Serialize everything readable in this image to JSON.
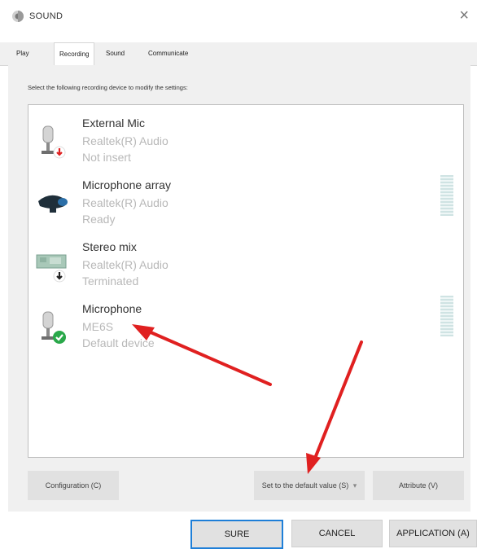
{
  "window": {
    "title": "SOUND",
    "close_glyph": "×"
  },
  "tabs": [
    {
      "label": "Play",
      "active": false
    },
    {
      "label": "Recording",
      "active": true
    },
    {
      "label": "Sound",
      "active": false
    },
    {
      "label": "Communicate",
      "active": false
    }
  ],
  "instruction": "Select the following recording device to modify the settings:",
  "devices": [
    {
      "name": "External Mic",
      "driver": "Realtek(R) Audio",
      "status": "Not insert",
      "icon": "microphone-icon",
      "badge": "red-down-arrow",
      "meter": false
    },
    {
      "name": "Microphone array",
      "driver": "Realtek(R) Audio",
      "status": "Ready",
      "icon": "webcam-icon",
      "badge": "none",
      "meter": true
    },
    {
      "name": "Stereo mix",
      "driver": "Realtek(R) Audio",
      "status": "Terminated",
      "icon": "sound-card-icon",
      "badge": "black-down-arrow",
      "meter": false
    },
    {
      "name": "Microphone",
      "driver": "ME6S",
      "status": "Default device",
      "icon": "microphone-icon",
      "badge": "green-check",
      "meter": true
    }
  ],
  "buttons": {
    "configure": "Configuration (C)",
    "set_default": "Set to the default value (S)",
    "properties": "Attribute (V)",
    "ok": "SURE",
    "cancel": "CANCEL",
    "apply": "APPLICATION (A)"
  },
  "colors": {
    "annotation_arrow": "#e02020",
    "default_badge": "#2aa84a",
    "focus_border": "#1e7fd8"
  }
}
